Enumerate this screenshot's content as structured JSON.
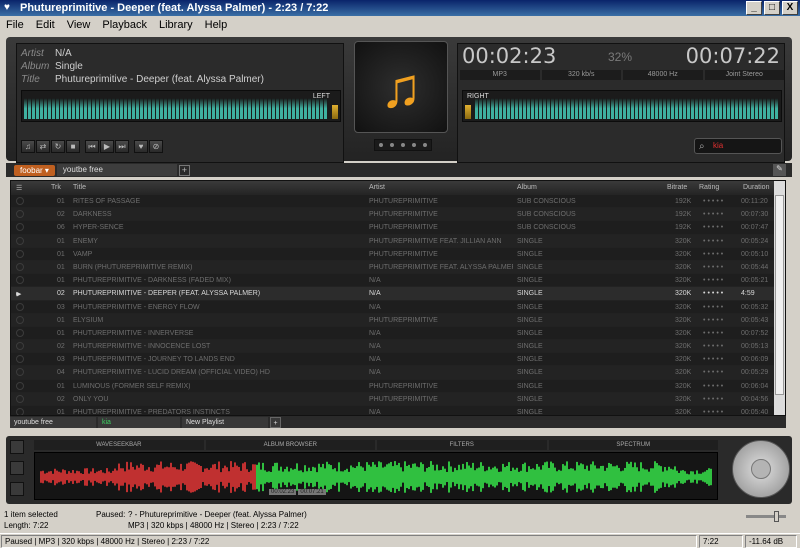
{
  "window": {
    "title": "Phutureprimitive - Deeper (feat. Alyssa Palmer) - 2:23 / 7:22",
    "min": "_",
    "max": "□",
    "close": "X"
  },
  "menu": [
    "File",
    "Edit",
    "View",
    "Playback",
    "Library",
    "Help"
  ],
  "now_playing": {
    "artist_label": "Artist",
    "artist": "N/A",
    "album_label": "Album",
    "album": "Single",
    "title_label": "Title",
    "title": "Phutureprimitive - Deeper (feat. Alyssa Palmer)",
    "vu_left": "LEFT",
    "vu_right": "RIGHT",
    "elapsed": "00:02:23",
    "percent": "32%",
    "total": "00:07:22",
    "codec": "MP3",
    "bitrate": "320 kb/s",
    "samplerate": "48000 Hz",
    "channels": "Joint Stereo"
  },
  "search": {
    "value": "kia"
  },
  "tabs": {
    "menu": "foobar ▾",
    "playlist": "youtbe free",
    "add": "+"
  },
  "columns": {
    "trk": "Trk",
    "title": "Title",
    "artist": "Artist",
    "album": "Album",
    "bitrate": "Bitrate",
    "rating": "Rating",
    "duration": "Duration"
  },
  "tracks": [
    {
      "trk": "01",
      "title": "RITES OF PASSAGE",
      "artist": "PHUTUREPRIMITIVE",
      "album": "SUB CONSCIOUS",
      "bitrate": "192K",
      "dur": "00:11:20"
    },
    {
      "trk": "02",
      "title": "DARKNESS",
      "artist": "PHUTUREPRIMITIVE",
      "album": "SUB CONSCIOUS",
      "bitrate": "192K",
      "dur": "00:07:30"
    },
    {
      "trk": "06",
      "title": "HYPER-SENCE",
      "artist": "PHUTUREPRIMITIVE",
      "album": "SUB CONSCIOUS",
      "bitrate": "192K",
      "dur": "00:07:47"
    },
    {
      "trk": "01",
      "title": "ENEMY",
      "artist": "PHUTUREPRIMITIVE FEAT. JILLIAN ANN",
      "album": "SINGLE",
      "bitrate": "320K",
      "dur": "00:05:24"
    },
    {
      "trk": "01",
      "title": "VAMP",
      "artist": "PHUTUREPRIMITIVE",
      "album": "SINGLE",
      "bitrate": "320K",
      "dur": "00:05:10"
    },
    {
      "trk": "01",
      "title": "BURN (PHUTUREPRIMITIVE REMIX)",
      "artist": "PHUTUREPRIMITIVE FEAT. ALYSSA PALMER",
      "album": "SINGLE",
      "bitrate": "320K",
      "dur": "00:05:44"
    },
    {
      "trk": "01",
      "title": "PHUTUREPRIMITIVE - DARKNESS (FADED MIX)",
      "artist": "N/A",
      "album": "SINGLE",
      "bitrate": "320K",
      "dur": "00:05:21"
    },
    {
      "trk": "02",
      "title": "PHUTUREPRIMITIVE - DEEPER (FEAT. ALYSSA PALMER)",
      "artist": "N/A",
      "album": "SINGLE",
      "bitrate": "320K",
      "dur": "4:59"
    },
    {
      "trk": "03",
      "title": "PHUTUREPRIMITIVE - ENERGY FLOW",
      "artist": "N/A",
      "album": "SINGLE",
      "bitrate": "320K",
      "dur": "00:05:32"
    },
    {
      "trk": "01",
      "title": "ELYSIUM",
      "artist": "PHUTUREPRIMITIVE",
      "album": "SINGLE",
      "bitrate": "320K",
      "dur": "00:05:43"
    },
    {
      "trk": "01",
      "title": "PHUTUREPRIMITIVE - INNERVERSE",
      "artist": "N/A",
      "album": "SINGLE",
      "bitrate": "320K",
      "dur": "00:07:52"
    },
    {
      "trk": "02",
      "title": "PHUTUREPRIMITIVE - INNOCENCE LOST",
      "artist": "N/A",
      "album": "SINGLE",
      "bitrate": "320K",
      "dur": "00:05:13"
    },
    {
      "trk": "03",
      "title": "PHUTUREPRIMITIVE - JOURNEY TO LANDS END",
      "artist": "N/A",
      "album": "SINGLE",
      "bitrate": "320K",
      "dur": "00:06:09"
    },
    {
      "trk": "04",
      "title": "PHUTUREPRIMITIVE - LUCID DREAM (OFFICIAL VIDEO) HD",
      "artist": "N/A",
      "album": "SINGLE",
      "bitrate": "320K",
      "dur": "00:05:29"
    },
    {
      "trk": "01",
      "title": "LUMINOUS (FORMER SELF REMIX)",
      "artist": "PHUTUREPRIMITIVE",
      "album": "SINGLE",
      "bitrate": "320K",
      "dur": "00:06:04"
    },
    {
      "trk": "02",
      "title": "ONLY YOU",
      "artist": "PHUTUREPRIMITIVE",
      "album": "SINGLE",
      "bitrate": "320K",
      "dur": "00:04:56"
    },
    {
      "trk": "01",
      "title": "PHUTUREPRIMITIVE - PREDATORS INSTINCTS",
      "artist": "N/A",
      "album": "SINGLE",
      "bitrate": "320K",
      "dur": "00:05:40"
    }
  ],
  "active_index": 7,
  "playlists": [
    "youtube free",
    "kia",
    "New Playlist"
  ],
  "bottom_tabs": [
    "WAVESEEKBAR",
    "ALBUM BROWSER",
    "FILTERS",
    "SPECTRUM"
  ],
  "wave_times": {
    "a": "00:02:23",
    "b": "00:07:21"
  },
  "status": {
    "selected": "1 item selected",
    "length": "Length: 7:22",
    "paused": "Paused:",
    "now": "? - Phutureprimitive - Deeper (feat. Alyssa Palmer)",
    "details": "MP3 | 320 kbps | 48000 Hz | Stereo | 2:23 / 7:22",
    "bar": "Paused | MP3 | 320 kbps | 48000 Hz | Stereo | 2:23 / 7:22",
    "time": "7:22",
    "volume": "-11.64 dB"
  },
  "colors": {
    "accent": "#f0a020",
    "played": "#c03030",
    "unplayed": "#30c040"
  }
}
